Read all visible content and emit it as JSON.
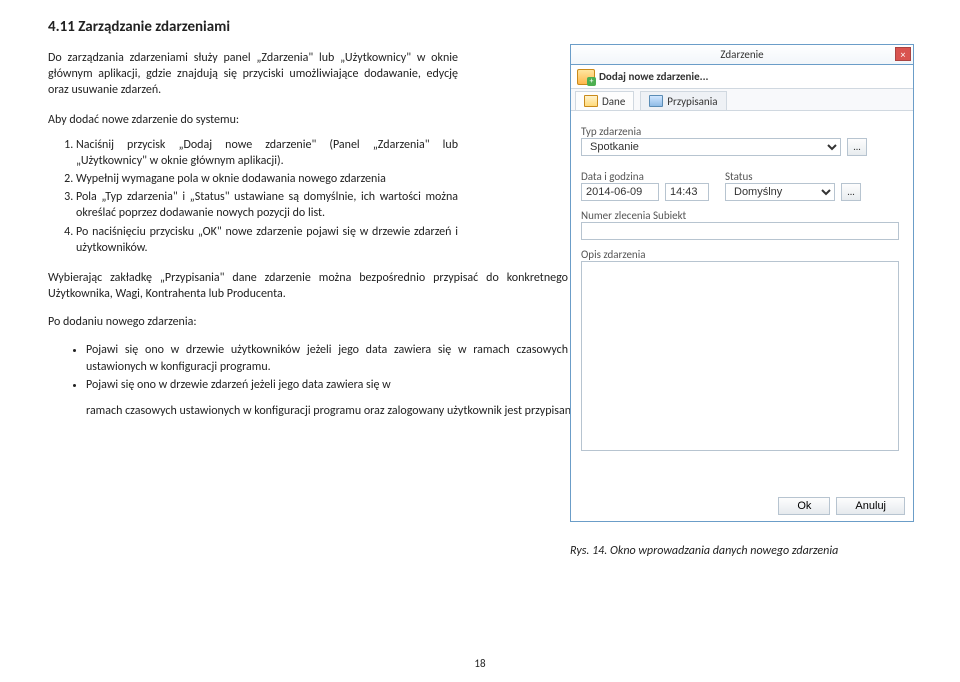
{
  "heading": "4.11 Zarządzanie zdarzeniami",
  "intro": "Do zarządzania zdarzeniami służy panel „Zdarzenia\" lub „Użytkownicy\" w oknie głównym aplikacji, gdzie znajdują się przyciski umożliwiające dodawanie, edycję oraz usuwanie zdarzeń.",
  "subhead": "Aby dodać nowe zdarzenie do systemu:",
  "steps": [
    "Naciśnij przycisk „Dodaj nowe zdarzenie\" (Panel „Zdarzenia\" lub „Użytkownicy\" w oknie głównym aplikacji).",
    "Wypełnij wymagane pola w oknie dodawania nowego zdarzenia",
    "Pola „Typ zdarzenia\" i „Status\" ustawiane są domyślnie, ich wartości można określać poprzez dodawanie nowych pozycji do list.",
    "Po naciśnięciu przycisku „OK\" nowe zdarzenie pojawi się w drzewie zdarzeń i użytkowników."
  ],
  "para1": "Wybierając zakładkę „Przypisania\" dane zdarzenie można bezpośrednio przypisać do konkretnego Użytkownika, Wagi, Kontrahenta lub Producenta.",
  "para2": "Po dodaniu nowego zdarzenia:",
  "bullets": [
    "Pojawi się ono w drzewie użytkowników jeżeli jego data zawiera się w ramach czasowych ustawionych w konfiguracji programu.",
    "Pojawi się ono w drzewie zdarzeń jeżeli jego data zawiera się w"
  ],
  "tail": "ramach czasowych ustawionych w konfiguracji programu oraz zalogowany użytkownik jest przypisany do tego zdarzenia.",
  "caption": "Rys. 14. Okno wprowadzania danych nowego zdarzenia",
  "page": "18",
  "dlg": {
    "title": "Zdarzenie",
    "close": "×",
    "toolbar_label": "Dodaj nowe zdarzenie...",
    "tab_dane": "Dane",
    "tab_przyp": "Przypisania",
    "lbl_typ": "Typ zdarzenia",
    "val_typ": "Spotkanie",
    "lbl_data": "Data i godzina",
    "val_data": "2014-06-09",
    "val_time": "14:43",
    "lbl_status": "Status",
    "val_status": "Domyślny",
    "lbl_numer": "Numer zlecenia Subiekt",
    "lbl_opis": "Opis zdarzenia",
    "btn_ok": "Ok",
    "btn_cancel": "Anuluj",
    "dots": "..."
  }
}
